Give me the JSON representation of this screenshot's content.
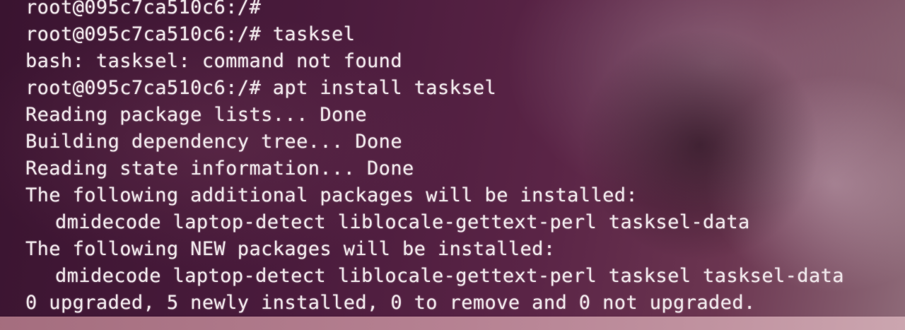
{
  "terminal": {
    "lines": [
      {
        "prompt": "root@095c7ca510c6:/#",
        "command": ""
      },
      {
        "prompt": "root@095c7ca510c6:/#",
        "command": "tasksel"
      },
      {
        "text": "bash: tasksel: command not found"
      },
      {
        "prompt": "root@095c7ca510c6:/#",
        "command": "apt install tasksel"
      },
      {
        "text": "Reading package lists... Done"
      },
      {
        "text": "Building dependency tree... Done"
      },
      {
        "text": "Reading state information... Done"
      },
      {
        "text": "The following additional packages will be installed:"
      },
      {
        "text": "dmidecode laptop-detect liblocale-gettext-perl tasksel-data"
      },
      {
        "text": "The following NEW packages will be installed:"
      },
      {
        "text": "dmidecode laptop-detect liblocale-gettext-perl tasksel tasksel-data"
      },
      {
        "text": "0 upgraded, 5 newly installed, 0 to remove and 0 not upgraded."
      }
    ]
  }
}
